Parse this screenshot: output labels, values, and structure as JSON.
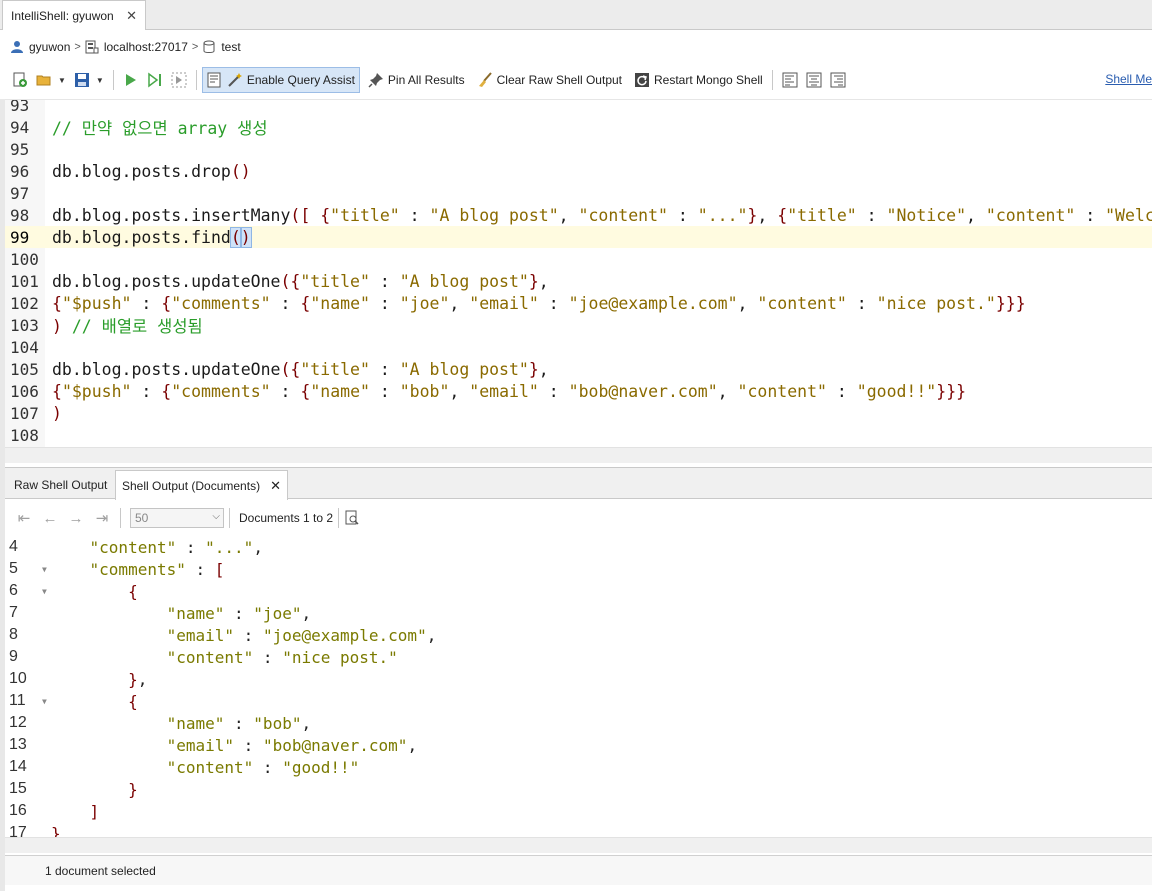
{
  "window_tab": {
    "title": "IntelliShell: gyuwon",
    "close": "✕"
  },
  "breadcrumb": {
    "user": "gyuwon",
    "server": "localhost:27017",
    "database": "test",
    "sep": ">"
  },
  "toolbar": {
    "enable_query_assist": "Enable Query Assist",
    "pin_all_results": "Pin All Results",
    "clear_raw_shell_output": "Clear Raw Shell Output",
    "restart_mongo_shell": "Restart Mongo Shell",
    "shell_link": "Shell Me"
  },
  "editor": {
    "lines": [
      {
        "n": "93",
        "text": ""
      },
      {
        "n": "94",
        "text": "// 만약 없으면 array 생성",
        "kind": "comment"
      },
      {
        "n": "95",
        "text": ""
      },
      {
        "n": "96",
        "text": "db.blog.posts.drop()"
      },
      {
        "n": "97",
        "text": ""
      },
      {
        "n": "98",
        "text": "db.blog.posts.insertMany([ {\"title\" : \"A blog post\", \"content\" : \"...\"}, {\"title\" : \"Notice\", \"content\" : \"Welcome!!\"}])"
      },
      {
        "n": "99",
        "text": "db.blog.posts.find()",
        "current": true
      },
      {
        "n": "100",
        "text": ""
      },
      {
        "n": "101",
        "text": "db.blog.posts.updateOne({\"title\" : \"A blog post\"},"
      },
      {
        "n": "102",
        "text": "{\"$push\" : {\"comments\" : {\"name\" : \"joe\", \"email\" : \"joe@example.com\", \"content\" : \"nice post.\"}}}"
      },
      {
        "n": "103",
        "text": ") // 배열로 생성됨"
      },
      {
        "n": "104",
        "text": ""
      },
      {
        "n": "105",
        "text": "db.blog.posts.updateOne({\"title\" : \"A blog post\"},"
      },
      {
        "n": "106",
        "text": "{\"$push\" : {\"comments\" : {\"name\" : \"bob\", \"email\" : \"bob@naver.com\", \"content\" : \"good!!\"}}}"
      },
      {
        "n": "107",
        "text": ")"
      },
      {
        "n": "108",
        "text": ""
      }
    ]
  },
  "lower_tabs": {
    "raw": "Raw Shell Output",
    "documents": "Shell Output (Documents)",
    "close": "✕"
  },
  "results": {
    "page_size": "50",
    "doc_count": "Documents 1 to 2",
    "lines": [
      {
        "n": "4",
        "text": "    \"content\" : \"...\","
      },
      {
        "n": "5",
        "text": "    \"comments\" : [",
        "fold": true
      },
      {
        "n": "6",
        "text": "        {",
        "fold": true
      },
      {
        "n": "7",
        "text": "            \"name\" : \"joe\","
      },
      {
        "n": "8",
        "text": "            \"email\" : \"joe@example.com\","
      },
      {
        "n": "9",
        "text": "            \"content\" : \"nice post.\""
      },
      {
        "n": "10",
        "text": "        },"
      },
      {
        "n": "11",
        "text": "        {",
        "fold": true
      },
      {
        "n": "12",
        "text": "            \"name\" : \"bob\","
      },
      {
        "n": "13",
        "text": "            \"email\" : \"bob@naver.com\","
      },
      {
        "n": "14",
        "text": "            \"content\" : \"good!!\""
      },
      {
        "n": "15",
        "text": "        }"
      },
      {
        "n": "16",
        "text": "    ]"
      },
      {
        "n": "17",
        "text": "}"
      }
    ]
  },
  "status": {
    "text": "1 document selected"
  },
  "colors": {
    "comment": "#2a9d2a",
    "string": "#8a6a00",
    "bracket": "#7a0000",
    "current_line": "#fffbe0",
    "link": "#2a5db0"
  }
}
